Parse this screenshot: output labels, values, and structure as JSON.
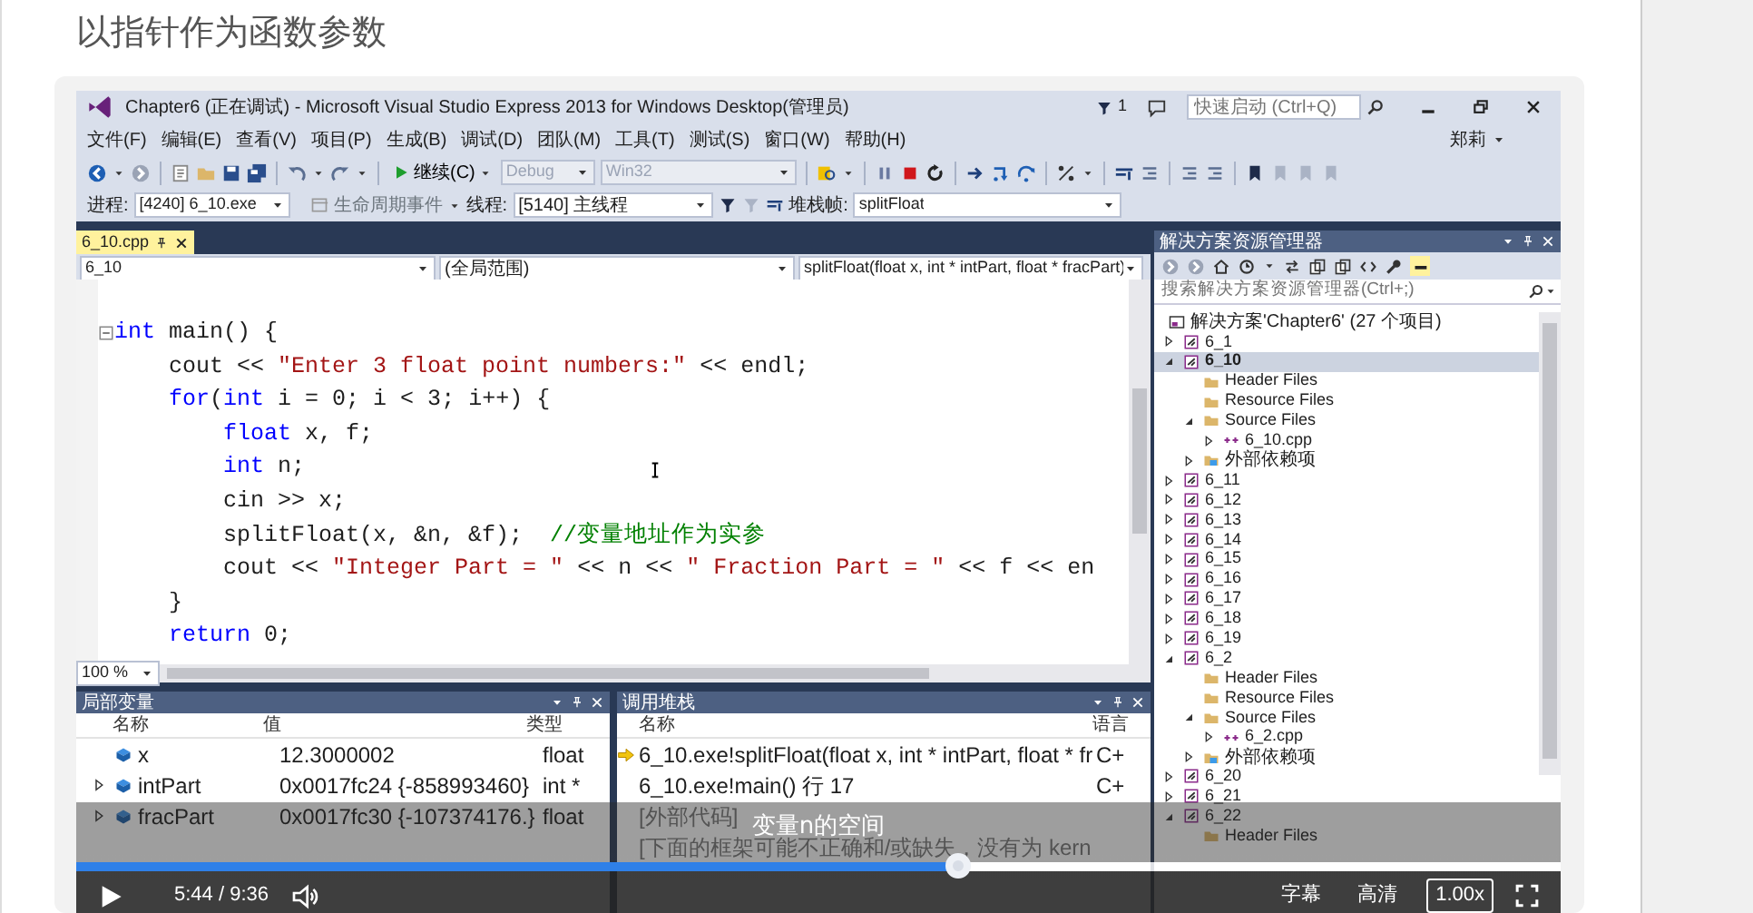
{
  "page_title": "以指针作为函数参数",
  "video": {
    "ide": {
      "title": "Chapter6 (正在调试) - Microsoft Visual Studio Express 2013 for Windows Desktop(管理员)",
      "notification_count": "1",
      "quick_launch": {
        "placeholder": "快速启动 (Ctrl+Q)"
      },
      "menu": [
        "文件(F)",
        "编辑(E)",
        "查看(V)",
        "项目(P)",
        "生成(B)",
        "调试(D)",
        "团队(M)",
        "工具(T)",
        "测试(S)",
        "窗口(W)",
        "帮助(H)"
      ],
      "user": "郑莉",
      "toolbar": {
        "continue_label": "继续(C)",
        "configuration": {
          "value": "Debug",
          "disabled": true
        },
        "platform": {
          "value": "Win32",
          "disabled": true
        }
      },
      "debug_bar": {
        "process_label": "进程:",
        "process": "[4240] 6_10.exe",
        "lifecycle": "生命周期事件",
        "thread_label": "线程:",
        "thread": "[5140] 主线程",
        "stack_label": "堆栈帧:",
        "stack_frame": "splitFloat"
      },
      "document_tab": {
        "label": "6_10.cpp",
        "selected": true
      },
      "navigation": {
        "project": "6_10",
        "scope": "(全局范围)",
        "member": "splitFloat(float x, int * intPart, float * fracPart)"
      },
      "code_lines": [
        {
          "foldable": true,
          "tokens": [
            {
              "kind": "keyword",
              "text": "int"
            },
            {
              "kind": "text",
              "text": " main() {"
            }
          ]
        },
        {
          "foldable": false,
          "tokens": [
            {
              "kind": "text",
              "text": "    cout << "
            },
            {
              "kind": "string",
              "text": "\"Enter 3 float point numbers:\""
            },
            {
              "kind": "text",
              "text": " << endl;"
            }
          ]
        },
        {
          "foldable": false,
          "tokens": [
            {
              "kind": "keyword",
              "text": "    for"
            },
            {
              "kind": "text",
              "text": "("
            },
            {
              "kind": "keyword",
              "text": "int"
            },
            {
              "kind": "text",
              "text": " i = 0; i < 3; i++) {"
            }
          ]
        },
        {
          "foldable": false,
          "tokens": [
            {
              "kind": "keyword",
              "text": "        float"
            },
            {
              "kind": "text",
              "text": " x, f;"
            }
          ]
        },
        {
          "foldable": false,
          "tokens": [
            {
              "kind": "keyword",
              "text": "        int"
            },
            {
              "kind": "text",
              "text": " n;"
            }
          ]
        },
        {
          "foldable": false,
          "tokens": [
            {
              "kind": "text",
              "text": "        cin >> x;"
            }
          ]
        },
        {
          "foldable": false,
          "tokens": [
            {
              "kind": "text",
              "text": "        splitFloat(x, &n, &f);  "
            },
            {
              "kind": "comment",
              "text": "//变量地址作为实参"
            }
          ]
        },
        {
          "foldable": false,
          "tokens": [
            {
              "kind": "text",
              "text": "        cout << "
            },
            {
              "kind": "string",
              "text": "\"Integer Part = \""
            },
            {
              "kind": "text",
              "text": " << n << "
            },
            {
              "kind": "string",
              "text": "\" Fraction Part = \""
            },
            {
              "kind": "text",
              "text": " << f << en"
            }
          ]
        },
        {
          "foldable": false,
          "tokens": [
            {
              "kind": "text",
              "text": "    }"
            }
          ]
        },
        {
          "foldable": false,
          "tokens": [
            {
              "kind": "keyword",
              "text": "    return"
            },
            {
              "kind": "text",
              "text": " 0;"
            }
          ]
        }
      ],
      "zoom": "100 %",
      "locals": {
        "title": "局部变量",
        "columns": [
          "名称",
          "值",
          "类型"
        ],
        "rows": [
          {
            "name": "x",
            "value": "12.3000002",
            "type": "float",
            "expandable": false
          },
          {
            "name": "intPart",
            "value": "0x0017fc24 {-858993460}",
            "type": "int *",
            "expandable": true
          },
          {
            "name": "fracPart",
            "value": "0x0017fc30 {-107374176.}",
            "type": "float",
            "expandable": true
          }
        ]
      },
      "call_stack": {
        "title": "调用堆栈",
        "columns": [
          "名称",
          "语言"
        ],
        "rows": [
          {
            "name": "6_10.exe!splitFloat(float x, int * intPart, float * fr",
            "language": "C+",
            "current": true
          },
          {
            "name": "6_10.exe!main() 行 17",
            "language": "C+",
            "current": false
          },
          {
            "name": "[外部代码]",
            "current": false
          },
          {
            "name": "[下面的框架可能不正确和/或缺失，没有为 kern",
            "current": false
          }
        ]
      },
      "solution_explorer": {
        "title": "解决方案资源管理器",
        "search": {
          "placeholder": "搜索解决方案资源管理器(Ctrl+;)"
        },
        "solution": "解决方案'Chapter6' (27 个项目)",
        "tree": [
          {
            "label": "6_1",
            "kind": "project",
            "expanded": false,
            "selected": false
          },
          {
            "label": "6_10",
            "kind": "project",
            "expanded": true,
            "selected": true,
            "children": [
              {
                "label": "Header Files",
                "kind": "folder",
                "selected": false
              },
              {
                "label": "Resource Files",
                "kind": "folder",
                "selected": false
              },
              {
                "label": "Source Files",
                "kind": "folder",
                "expanded": true,
                "selected": false,
                "children": [
                  {
                    "label": "6_10.cpp",
                    "kind": "file",
                    "expanded": false,
                    "selected": false
                  }
                ]
              },
              {
                "label": "外部依赖项",
                "kind": "references",
                "expanded": false,
                "selected": false
              }
            ]
          },
          {
            "label": "6_11",
            "kind": "project",
            "expanded": false,
            "selected": false
          },
          {
            "label": "6_12",
            "kind": "project",
            "expanded": false,
            "selected": false
          },
          {
            "label": "6_13",
            "kind": "project",
            "expanded": false,
            "selected": false
          },
          {
            "label": "6_14",
            "kind": "project",
            "expanded": false,
            "selected": false
          },
          {
            "label": "6_15",
            "kind": "project",
            "expanded": false,
            "selected": false
          },
          {
            "label": "6_16",
            "kind": "project",
            "expanded": false,
            "selected": false
          },
          {
            "label": "6_17",
            "kind": "project",
            "expanded": false,
            "selected": false
          },
          {
            "label": "6_18",
            "kind": "project",
            "expanded": false,
            "selected": false
          },
          {
            "label": "6_19",
            "kind": "project",
            "expanded": false,
            "selected": false
          },
          {
            "label": "6_2",
            "kind": "project",
            "expanded": true,
            "selected": false,
            "children": [
              {
                "label": "Header Files",
                "kind": "folder",
                "selected": false
              },
              {
                "label": "Resource Files",
                "kind": "folder",
                "selected": false
              },
              {
                "label": "Source Files",
                "kind": "folder",
                "expanded": true,
                "selected": false,
                "children": [
                  {
                    "label": "6_2.cpp",
                    "kind": "file",
                    "expanded": false,
                    "selected": false
                  }
                ]
              },
              {
                "label": "外部依赖项",
                "kind": "references",
                "expanded": false,
                "selected": false
              }
            ]
          },
          {
            "label": "6_20",
            "kind": "project",
            "expanded": false,
            "selected": false
          },
          {
            "label": "6_21",
            "kind": "project",
            "expanded": false,
            "selected": false
          },
          {
            "label": "6_22",
            "kind": "project",
            "expanded": true,
            "selected": false,
            "children": [
              {
                "label": "Header Files",
                "kind": "folder",
                "selected": false
              }
            ]
          }
        ]
      }
    },
    "subtitle": "变量n的空间",
    "player": {
      "level": 0.594,
      "time": "5:44 / 9:36",
      "buttons": [
        "字幕",
        "高清",
        "1.00x"
      ]
    }
  }
}
